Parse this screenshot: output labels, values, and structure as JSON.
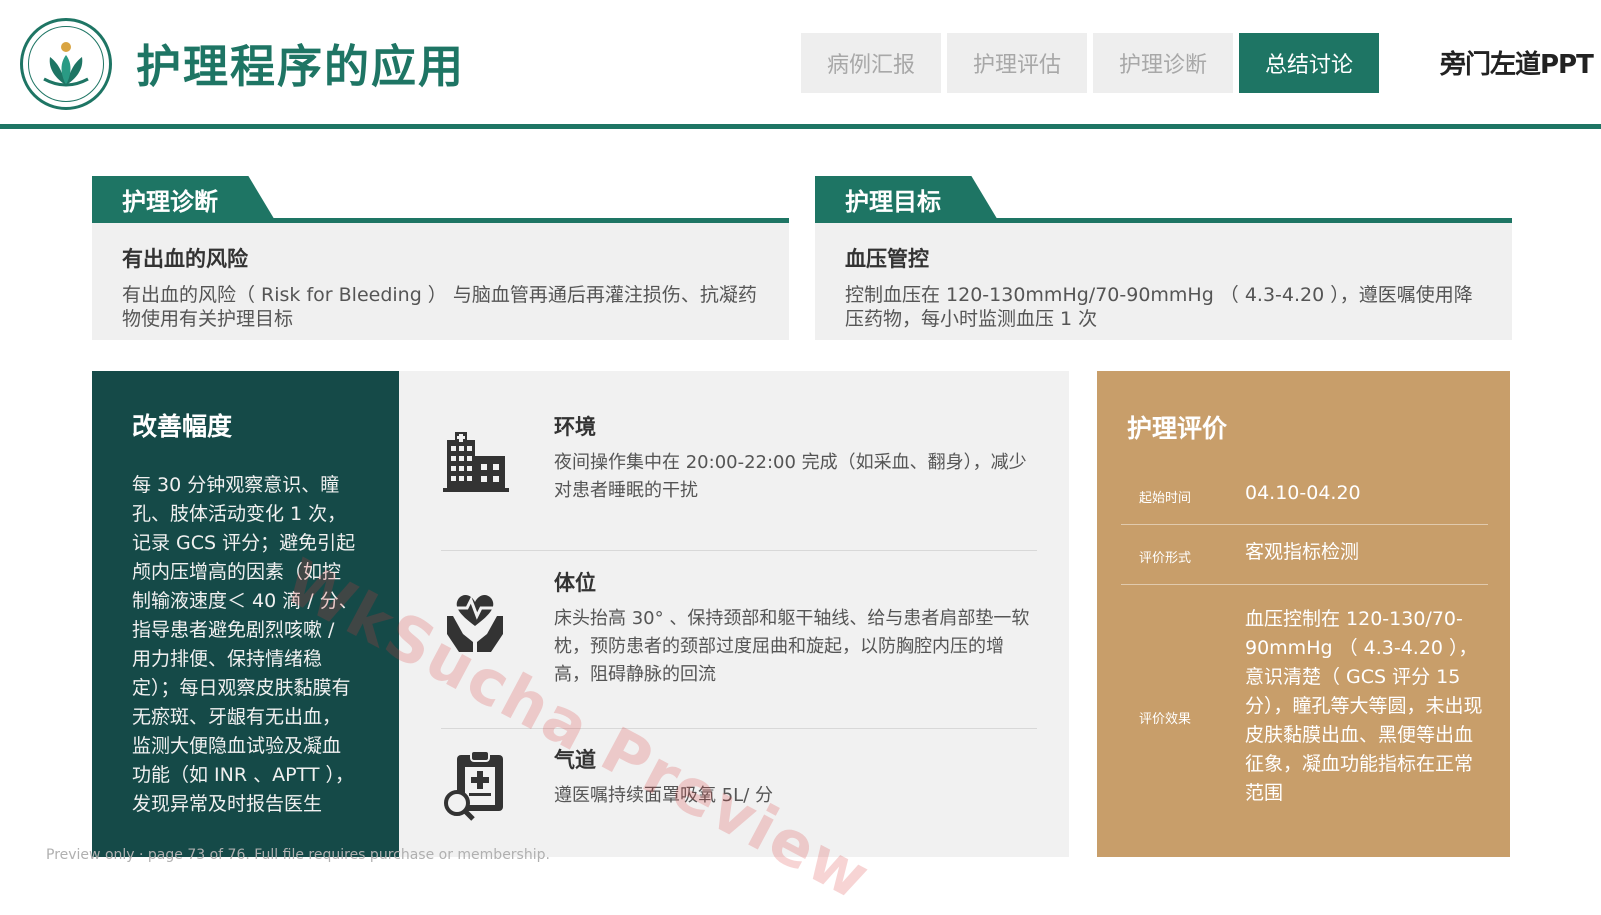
{
  "header": {
    "title": "护理程序的应用",
    "brand": "旁门左道PPT",
    "tabs": [
      {
        "label": "病例汇报",
        "active": false
      },
      {
        "label": "护理评估",
        "active": false
      },
      {
        "label": "护理诊断",
        "active": false
      },
      {
        "label": "总结讨论",
        "active": true
      }
    ]
  },
  "diagnosis": {
    "tab": "护理诊断",
    "heading": "有出血的风险",
    "text": "有出血的风险（ Risk for Bleeding ） 与脑血管再通后再灌注损伤、抗凝药物使用有关护理目标"
  },
  "goal": {
    "tab": "护理目标",
    "heading": "血压管控",
    "text": "控制血压在 120-130mmHg/70-90mmHg （ 4.3-4.20 ），遵医嘱使用降压药物，每小时监测血压 1 次"
  },
  "improvement": {
    "title": "改善幅度",
    "text": "每 30 分钟观察意识、瞳孔、肢体活动变化 1 次，记录 GCS 评分；避免引起颅内压增高的因素（如控制输液速度＜ 40 滴 / 分、指导患者避免剧烈咳嗽 / 用力排便、保持情绪稳定）；每日观察皮肤黏膜有无瘀斑、牙龈有无出血，监测大便隐血试验及凝血功能（如 INR 、APTT ），发现异常及时报告医生"
  },
  "items": [
    {
      "title": "环境",
      "text": "夜间操作集中在 20:00-22:00 完成（如采血、翻身），减少对患者睡眠的干扰",
      "icon": "hospital-icon"
    },
    {
      "title": "体位",
      "text": "床头抬高 30° 、保持颈部和躯干轴线、给与患者肩部垫一软枕，预防患者的颈部过度屈曲和旋起，以防胸腔内压的增高，阻碍静脉的回流",
      "icon": "care-heart-icon"
    },
    {
      "title": "气道",
      "text": "遵医嘱持续面罩吸氧 5L/ 分",
      "icon": "clipboard-search-icon"
    }
  ],
  "evaluation": {
    "title": "护理评价",
    "rows": [
      {
        "label": "起始时间",
        "value": "04.10-04.20"
      },
      {
        "label": "评价形式",
        "value": "客观指标检测"
      },
      {
        "label": "评价效果",
        "value": "血压控制在 120-130/70-90mmHg （ 4.3-4.20 ），意识清楚（ GCS 评分 15 分），瞳孔等大等圆，未出现皮肤黏膜出血、黑便等出血征象，凝血功能指标在正常范围"
      }
    ]
  },
  "watermark": "WkSucha Preview",
  "preview_note": "Preview only · page 73 of 76. Full file requires purchase or membership.",
  "colors": {
    "primary": "#1e7564",
    "dark_teal": "#154a48",
    "tan": "#c89e6a",
    "panel": "#f0f0f0"
  }
}
